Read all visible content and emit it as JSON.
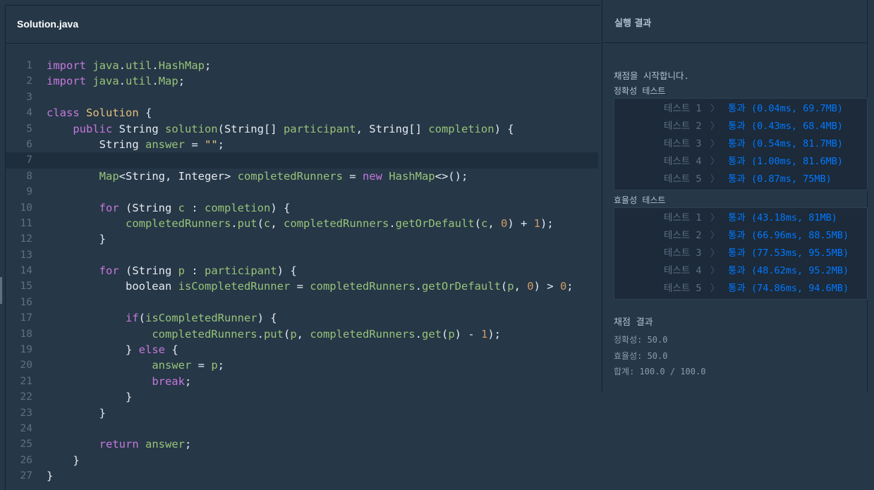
{
  "editor": {
    "file_name": "Solution.java",
    "lines": [
      [
        [
          "k",
          "import"
        ],
        [
          "p",
          " "
        ],
        [
          "v",
          "java"
        ],
        [
          "p",
          "."
        ],
        [
          "v",
          "util"
        ],
        [
          "p",
          "."
        ],
        [
          "v",
          "HashMap"
        ],
        [
          "p",
          ";"
        ]
      ],
      [
        [
          "k",
          "import"
        ],
        [
          "p",
          " "
        ],
        [
          "v",
          "java"
        ],
        [
          "p",
          "."
        ],
        [
          "v",
          "util"
        ],
        [
          "p",
          "."
        ],
        [
          "v",
          "Map"
        ],
        [
          "p",
          ";"
        ]
      ],
      [],
      [
        [
          "k",
          "class"
        ],
        [
          "p",
          " "
        ],
        [
          "t",
          "Solution"
        ],
        [
          "p",
          " {"
        ]
      ],
      [
        [
          "p",
          "    "
        ],
        [
          "k",
          "public"
        ],
        [
          "p",
          " String "
        ],
        [
          "v",
          "solution"
        ],
        [
          "p",
          "(String[] "
        ],
        [
          "v",
          "participant"
        ],
        [
          "p",
          ", String[] "
        ],
        [
          "v",
          "completion"
        ],
        [
          "p",
          ") {"
        ]
      ],
      [
        [
          "p",
          "        String "
        ],
        [
          "v",
          "answer"
        ],
        [
          "p",
          " = "
        ],
        [
          "s",
          "\"\""
        ],
        [
          "p",
          ";"
        ]
      ],
      [],
      [
        [
          "p",
          "        "
        ],
        [
          "v",
          "Map"
        ],
        [
          "p",
          "<String, Integer> "
        ],
        [
          "v",
          "completedRunners"
        ],
        [
          "p",
          " = "
        ],
        [
          "k",
          "new"
        ],
        [
          "p",
          " "
        ],
        [
          "v",
          "HashMap"
        ],
        [
          "p",
          "<>();"
        ]
      ],
      [],
      [
        [
          "p",
          "        "
        ],
        [
          "k",
          "for"
        ],
        [
          "p",
          " (String "
        ],
        [
          "v",
          "c"
        ],
        [
          "p",
          " : "
        ],
        [
          "v",
          "completion"
        ],
        [
          "p",
          ") {"
        ]
      ],
      [
        [
          "p",
          "            "
        ],
        [
          "v",
          "completedRunners"
        ],
        [
          "p",
          "."
        ],
        [
          "v",
          "put"
        ],
        [
          "p",
          "("
        ],
        [
          "v",
          "c"
        ],
        [
          "p",
          ", "
        ],
        [
          "v",
          "completedRunners"
        ],
        [
          "p",
          "."
        ],
        [
          "v",
          "getOrDefault"
        ],
        [
          "p",
          "("
        ],
        [
          "v",
          "c"
        ],
        [
          "p",
          ", "
        ],
        [
          "n",
          "0"
        ],
        [
          "p",
          ") + "
        ],
        [
          "n",
          "1"
        ],
        [
          "p",
          ");"
        ]
      ],
      [
        [
          "p",
          "        }"
        ]
      ],
      [],
      [
        [
          "p",
          "        "
        ],
        [
          "k",
          "for"
        ],
        [
          "p",
          " (String "
        ],
        [
          "v",
          "p"
        ],
        [
          "p",
          " : "
        ],
        [
          "v",
          "participant"
        ],
        [
          "p",
          ") {"
        ]
      ],
      [
        [
          "p",
          "            boolean "
        ],
        [
          "v",
          "isCompletedRunner"
        ],
        [
          "p",
          " = "
        ],
        [
          "v",
          "completedRunners"
        ],
        [
          "p",
          "."
        ],
        [
          "v",
          "getOrDefault"
        ],
        [
          "p",
          "("
        ],
        [
          "v",
          "p"
        ],
        [
          "p",
          ", "
        ],
        [
          "n",
          "0"
        ],
        [
          "p",
          ") > "
        ],
        [
          "n",
          "0"
        ],
        [
          "p",
          ";"
        ]
      ],
      [],
      [
        [
          "p",
          "            "
        ],
        [
          "k",
          "if"
        ],
        [
          "p",
          "("
        ],
        [
          "v",
          "isCompletedRunner"
        ],
        [
          "p",
          ") {"
        ]
      ],
      [
        [
          "p",
          "                "
        ],
        [
          "v",
          "completedRunners"
        ],
        [
          "p",
          "."
        ],
        [
          "v",
          "put"
        ],
        [
          "p",
          "("
        ],
        [
          "v",
          "p"
        ],
        [
          "p",
          ", "
        ],
        [
          "v",
          "completedRunners"
        ],
        [
          "p",
          "."
        ],
        [
          "v",
          "get"
        ],
        [
          "p",
          "("
        ],
        [
          "v",
          "p"
        ],
        [
          "p",
          ") - "
        ],
        [
          "n",
          "1"
        ],
        [
          "p",
          ");"
        ]
      ],
      [
        [
          "p",
          "            } "
        ],
        [
          "k",
          "else"
        ],
        [
          "p",
          " {"
        ]
      ],
      [
        [
          "p",
          "                "
        ],
        [
          "v",
          "answer"
        ],
        [
          "p",
          " = "
        ],
        [
          "v",
          "p"
        ],
        [
          "p",
          ";"
        ]
      ],
      [
        [
          "p",
          "                "
        ],
        [
          "k",
          "break"
        ],
        [
          "p",
          ";"
        ]
      ],
      [
        [
          "p",
          "            }"
        ]
      ],
      [
        [
          "p",
          "        }"
        ]
      ],
      [],
      [
        [
          "p",
          "        "
        ],
        [
          "k",
          "return"
        ],
        [
          "p",
          " "
        ],
        [
          "v",
          "answer"
        ],
        [
          "p",
          ";"
        ]
      ],
      [
        [
          "p",
          "    }"
        ]
      ],
      [
        [
          "p",
          "}"
        ]
      ]
    ],
    "active_line": 7
  },
  "results": {
    "title": "실행 결과",
    "start_message": "채점을 시작합니다.",
    "accuracy_label": "정확성  테스트",
    "efficiency_label": "효율성  테스트",
    "accuracy_tests": [
      {
        "name": "테스트 1",
        "result": "통과 (0.04ms, 69.7MB)"
      },
      {
        "name": "테스트 2",
        "result": "통과 (0.43ms, 68.4MB)"
      },
      {
        "name": "테스트 3",
        "result": "통과 (0.54ms, 81.7MB)"
      },
      {
        "name": "테스트 4",
        "result": "통과 (1.00ms, 81.6MB)"
      },
      {
        "name": "테스트 5",
        "result": "통과 (0.87ms, 75MB)"
      }
    ],
    "efficiency_tests": [
      {
        "name": "테스트 1",
        "result": "통과 (43.18ms, 81MB)"
      },
      {
        "name": "테스트 2",
        "result": "통과 (66.96ms, 88.5MB)"
      },
      {
        "name": "테스트 3",
        "result": "통과 (77.53ms, 95.5MB)"
      },
      {
        "name": "테스트 4",
        "result": "통과 (48.62ms, 95.2MB)"
      },
      {
        "name": "테스트 5",
        "result": "통과 (74.86ms, 94.6MB)"
      }
    ],
    "summary_title": "채점 결과",
    "accuracy_score": "정확성: 50.0",
    "efficiency_score": "효율성: 50.0",
    "total_score": "합계: 100.0 / 100.0"
  }
}
